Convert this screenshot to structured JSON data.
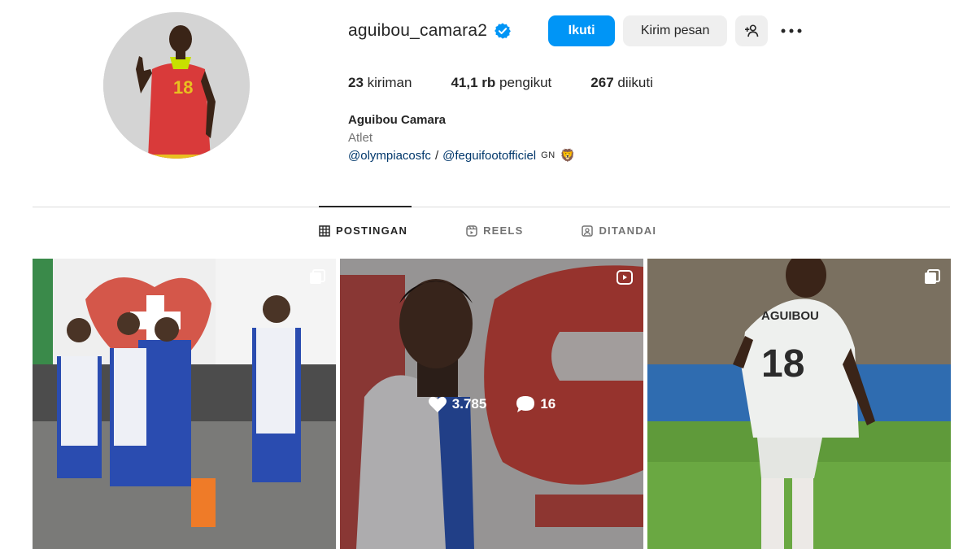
{
  "profile": {
    "username": "aguibou_camara2",
    "verified": true,
    "follow_label": "Ikuti",
    "message_label": "Kirim pesan",
    "suggest_icon": "add-user-icon",
    "more_icon": "more-options-icon",
    "stats": {
      "posts_count": "23",
      "posts_label": "kiriman",
      "followers_count": "41,1 rb",
      "followers_label": "pengikut",
      "following_count": "267",
      "following_label": "diikuti"
    },
    "full_name": "Aguibou Camara",
    "category": "Atlet",
    "bio_link_1": "@olympiacosfc",
    "bio_separator": "/",
    "bio_link_2": "@feguifootofficiel",
    "bio_flag": "GN",
    "bio_emoji": "🦁"
  },
  "tabs": [
    {
      "label": "POSTINGAN",
      "icon": "grid-icon",
      "active": true
    },
    {
      "label": "REELS",
      "icon": "reels-icon",
      "active": false
    },
    {
      "label": "DITANDAI",
      "icon": "tagged-icon",
      "active": false
    }
  ],
  "posts": [
    {
      "type": "carousel",
      "badge_icon": "carousel-icon"
    },
    {
      "type": "reel",
      "badge_icon": "reel-icon",
      "likes": "3.785",
      "comments": "16"
    },
    {
      "type": "carousel",
      "badge_icon": "carousel-icon"
    }
  ],
  "colors": {
    "accent": "#0095f6",
    "link": "#00376b",
    "secondary_button": "#efefef"
  }
}
